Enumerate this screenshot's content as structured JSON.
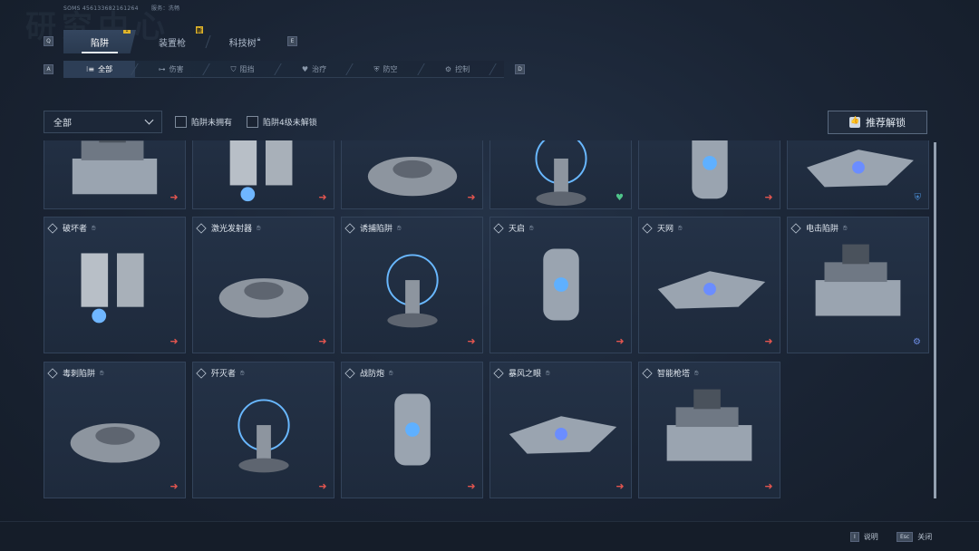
{
  "header": {
    "watermark": "研究中心",
    "player_id": "SOMS  456133682161264",
    "region": "服务：洗畅"
  },
  "keys": {
    "prev_main": "Q",
    "next_main": "E",
    "prev_sub": "A",
    "next_sub": "D"
  },
  "main_tabs": [
    {
      "label": "陷阱",
      "badge": "!",
      "active": true
    },
    {
      "label": "装置枪",
      "badge": "新",
      "active": false
    },
    {
      "label": "科技树",
      "badge": "",
      "active": false
    }
  ],
  "sub_tabs": [
    {
      "label": "全部",
      "icon": "list-icon",
      "glyph": "⁝≡",
      "active": true
    },
    {
      "label": "伤害",
      "icon": "damage-icon",
      "glyph": "⊶",
      "active": false
    },
    {
      "label": "阻挡",
      "icon": "block-icon",
      "glyph": "⛉",
      "active": false
    },
    {
      "label": "治疗",
      "icon": "heal-icon",
      "glyph": "♥",
      "active": false
    },
    {
      "label": "防空",
      "icon": "antiair-icon",
      "glyph": "⛨",
      "active": false
    },
    {
      "label": "控制",
      "icon": "control-icon",
      "glyph": "⚙",
      "active": false
    }
  ],
  "filters": {
    "dropdown_value": "全部",
    "check_not_owned": "陷阱未拥有",
    "check_lv4_locked": "陷阱4级未解锁",
    "recommend_label": "推荐解锁"
  },
  "cards_row0": [
    {
      "name": "",
      "role": "arrow"
    },
    {
      "name": "",
      "role": "arrow"
    },
    {
      "name": "",
      "role": "arrow"
    },
    {
      "name": "",
      "role": "heal"
    },
    {
      "name": "",
      "role": "arrow"
    },
    {
      "name": "",
      "role": "shield"
    }
  ],
  "cards_row1": [
    {
      "name": "破坏者",
      "role": "arrow"
    },
    {
      "name": "激光发射器",
      "role": "arrow"
    },
    {
      "name": "诱捕陷阱",
      "role": "arrow"
    },
    {
      "name": "天启",
      "role": "arrow"
    },
    {
      "name": "天网",
      "role": "arrow"
    },
    {
      "name": "电击陷阱",
      "role": "control"
    }
  ],
  "cards_row2": [
    {
      "name": "毒刺陷阱",
      "role": "arrow"
    },
    {
      "name": "歼灭者",
      "role": "arrow"
    },
    {
      "name": "战防炮",
      "role": "arrow"
    },
    {
      "name": "暴风之眼",
      "role": "arrow"
    },
    {
      "name": "智能枪塔",
      "role": "arrow"
    }
  ],
  "footer": {
    "help_key": "I",
    "help_label": "说明",
    "close_key": "Esc",
    "close_label": "关闭"
  },
  "colors": {
    "accent": "#e2554f",
    "heal": "#4fc48a",
    "shield": "#4a8fd8",
    "control": "#6f8fe8",
    "badge": "#e0b42a"
  }
}
